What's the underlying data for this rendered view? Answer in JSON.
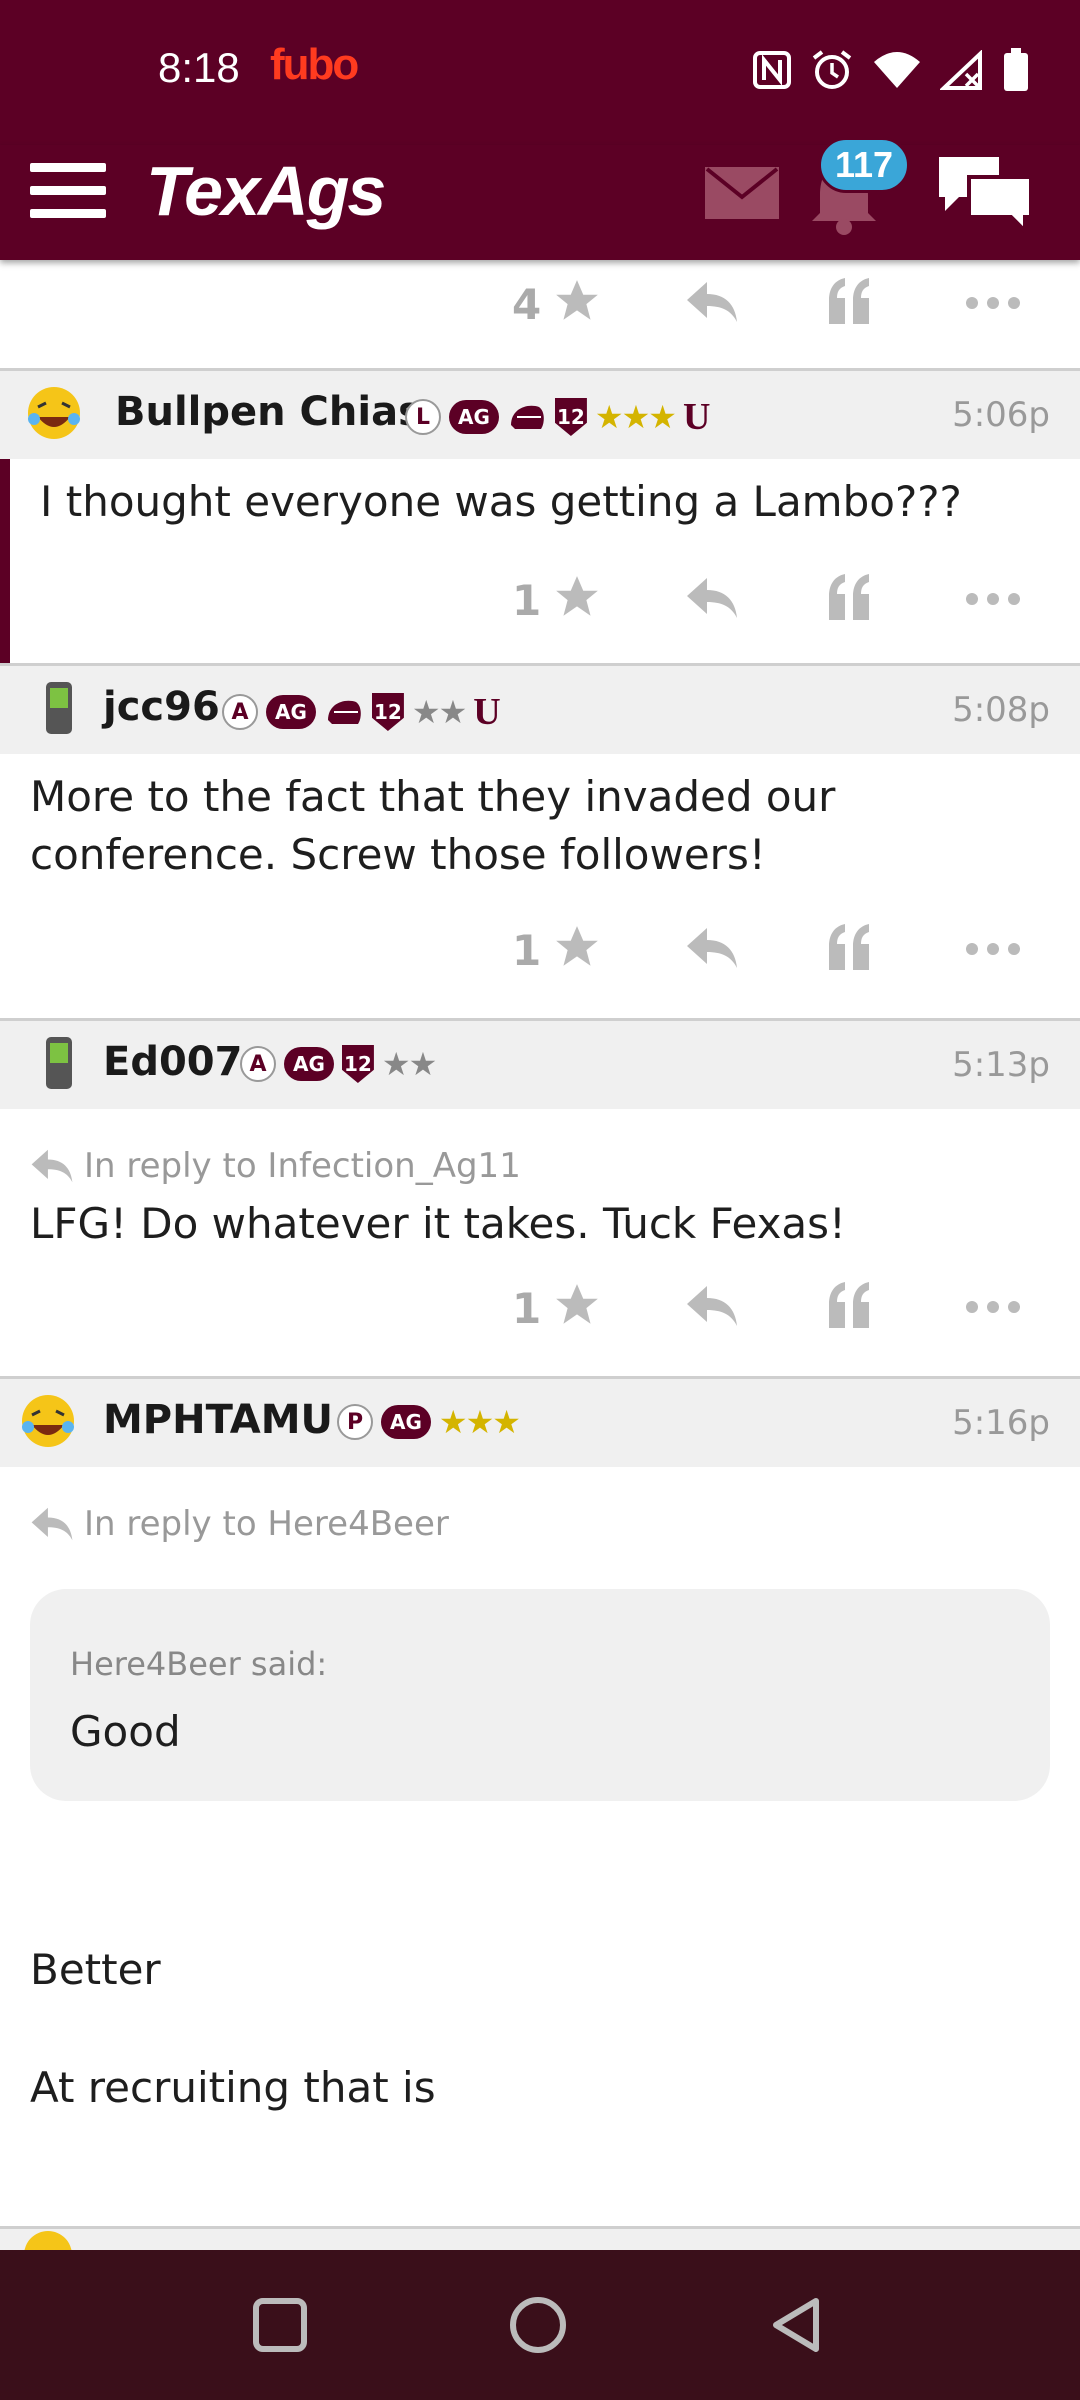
{
  "status": {
    "time": "8:18",
    "app_badge": "fubo"
  },
  "header": {
    "logo": "TexAgs",
    "notifications_count": "117"
  },
  "top_actions": {
    "count": "4"
  },
  "posts": [
    {
      "username": "Bullpen Chias",
      "flair_letter": "L",
      "flair_ag": "AG",
      "flair_12": "12",
      "flair_stars": "★★★",
      "flair_u": "U",
      "time": "5:06p",
      "text": "I thought everyone was getting a Lambo???",
      "likes": "1"
    },
    {
      "username": "jcc96",
      "flair_letter": "A",
      "flair_ag": "AG",
      "flair_12": "12",
      "flair_stars": "★★",
      "flair_u": "U",
      "time": "5:08p",
      "text": "More to the fact that they invaded our conference. Screw those followers!",
      "likes": "1"
    },
    {
      "username": "Ed007",
      "flair_letter": "A",
      "flair_ag": "AG",
      "flair_12": "12",
      "flair_stars": "★★",
      "time": "5:13p",
      "reply_to": "In reply to Infection_Ag11",
      "text": "LFG! Do whatever it takes. Tuck Fexas!",
      "likes": "1"
    },
    {
      "username": "MPHTAMU",
      "flair_letter": "P",
      "flair_ag": "AG",
      "flair_stars": "★★★",
      "time": "5:16p",
      "reply_to": "In reply to Here4Beer",
      "quote_author": "Here4Beer said:",
      "quote_text": "Good",
      "text_line1": "Better",
      "text_line2": "At recruiting that is",
      "likes": ""
    }
  ],
  "colors": {
    "brand": "#5c0025",
    "badge": "#3aa6d8",
    "star_gold": "#d4b400"
  },
  "icons": [
    "menu-icon",
    "mail-icon",
    "bell-icon",
    "chat-icon",
    "star-icon",
    "reply-icon",
    "quote-icon",
    "more-icon",
    "square-nav-icon",
    "circle-nav-icon",
    "back-nav-icon"
  ]
}
